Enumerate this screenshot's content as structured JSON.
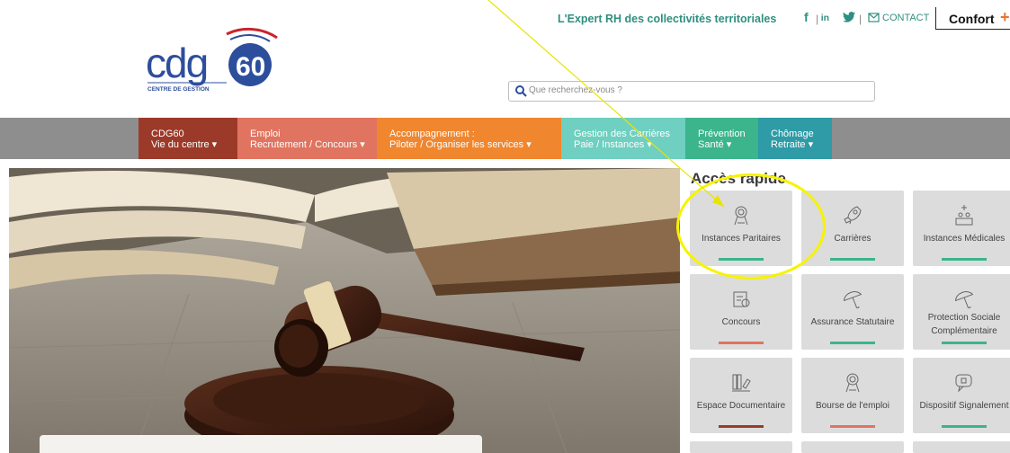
{
  "header": {
    "tagline": "L'Expert RH des collectivités territoriales",
    "separator": "|",
    "social": [
      {
        "icon": "facebook-icon",
        "glyph": "f"
      },
      {
        "icon": "linkedin-icon",
        "glyph": "in"
      },
      {
        "icon": "twitter-icon",
        "glyph": "🐦"
      }
    ],
    "contact_label": "CONTACT",
    "confort_label": "Confort",
    "confort_plus": "+"
  },
  "logo": {
    "brand": "cdg",
    "number": "60",
    "subtitle": "CENTRE DE GESTION",
    "colors": {
      "blue": "#2d4e9c",
      "red": "#c8242e"
    }
  },
  "search": {
    "placeholder": "Que recherchez-vous ?",
    "icon": "search-icon"
  },
  "nav": {
    "items": [
      {
        "line1": "CDG60",
        "line2": "Vie du centre ▾",
        "color": "#9c3a2a"
      },
      {
        "line1": "Emploi",
        "line2": "Recrutement / Concours ▾",
        "color": "#e07460"
      },
      {
        "line1": "Accompagnement :",
        "line2": "Piloter / Organiser les services ▾",
        "color": "#f0862e"
      },
      {
        "line1": "Gestion des Carrières",
        "line2": "Paie / Instances ▾",
        "color": "#6fcfc0"
      },
      {
        "line1": "Prévention",
        "line2": "Santé ▾",
        "color": "#3cb48c"
      },
      {
        "line1": "Chômage",
        "line2": "Retraite ▾",
        "color": "#2e9ba6"
      }
    ],
    "bar_color": "#8e8e8e"
  },
  "quick_access": {
    "title": "Accès rapide",
    "tiles": [
      {
        "label1": "Instances Paritaires",
        "label2": "",
        "icon": "ribbon-award-icon",
        "bar": "#3cb48c"
      },
      {
        "label1": "Carrières",
        "label2": "",
        "icon": "rocket-icon",
        "bar": "#3cb48c"
      },
      {
        "label1": "Instances Médicales",
        "label2": "",
        "icon": "medical-panel-icon",
        "bar": "#3cb48c"
      },
      {
        "label1": "Concours",
        "label2": "",
        "icon": "diploma-icon",
        "bar": "#e07460"
      },
      {
        "label1": "Assurance Statutaire",
        "label2": "",
        "icon": "umbrella-icon",
        "bar": "#3cb48c"
      },
      {
        "label1": "Protection Sociale",
        "label2": "Complémentaire",
        "icon": "umbrella-icon",
        "bar": "#3cb48c"
      },
      {
        "label1": "Espace Documentaire",
        "label2": "",
        "icon": "library-icon",
        "bar": "#9c3a2a"
      },
      {
        "label1": "Bourse de l'emploi",
        "label2": "",
        "icon": "ribbon-award-icon",
        "bar": "#e07460"
      },
      {
        "label1": "Dispositif Signalement",
        "label2": "",
        "icon": "chat-alert-icon",
        "bar": "#3cb48c"
      }
    ]
  },
  "annotation": {
    "color": "#f7f300"
  }
}
